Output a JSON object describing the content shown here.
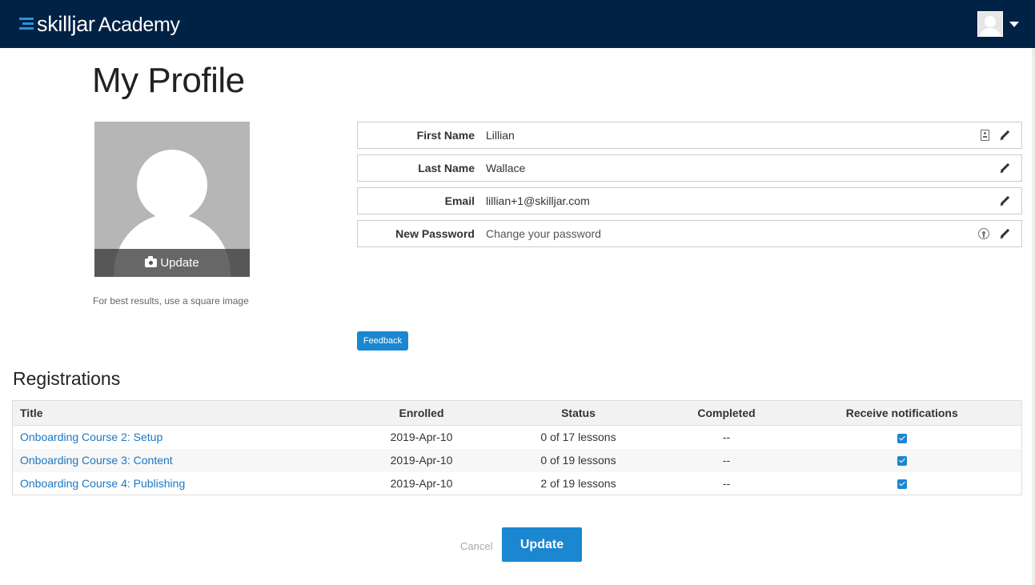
{
  "header": {
    "brand": "skilljar",
    "product": "Academy"
  },
  "page": {
    "title": "My Profile"
  },
  "photo": {
    "update_label": "Update",
    "hint": "For best results, use a square image"
  },
  "fields": [
    {
      "label": "First Name",
      "value": "Lillian"
    },
    {
      "label": "Last Name",
      "value": "Wallace"
    },
    {
      "label": "Email",
      "value": "lillian+1@skilljar.com"
    },
    {
      "label": "New Password",
      "placeholder": "Change your password"
    }
  ],
  "feedback_label": "Feedback",
  "registrations": {
    "title": "Registrations",
    "columns": [
      "Title",
      "Enrolled",
      "Status",
      "Completed",
      "Receive notifications"
    ],
    "rows": [
      {
        "title": "Onboarding Course 2: Setup",
        "enrolled": "2019-Apr-10",
        "status": "0 of 17 lessons",
        "completed": "--",
        "notify": true
      },
      {
        "title": "Onboarding Course 3: Content",
        "enrolled": "2019-Apr-10",
        "status": "0 of 19 lessons",
        "completed": "--",
        "notify": true
      },
      {
        "title": "Onboarding Course 4: Publishing",
        "enrolled": "2019-Apr-10",
        "status": "2 of 19 lessons",
        "completed": "--",
        "notify": true
      }
    ]
  },
  "actions": {
    "cancel_label": "Cancel",
    "update_label": "Update"
  },
  "colors": {
    "header_bg": "#002244",
    "accent": "#1a87d0",
    "link": "#1a77c4"
  }
}
